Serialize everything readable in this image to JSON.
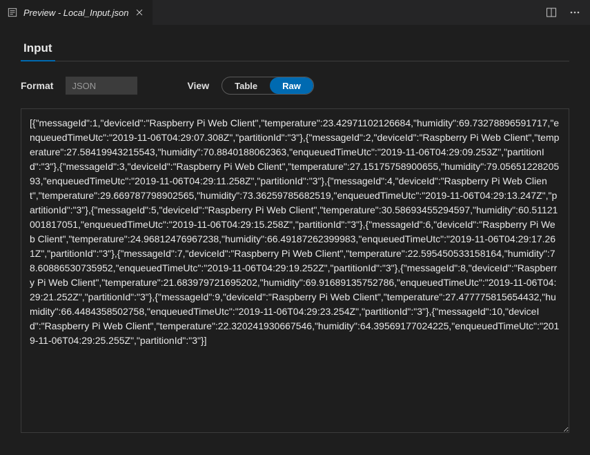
{
  "titlebar": {
    "tab_label": "Preview - Local_Input.json"
  },
  "section_tabs": {
    "input": "Input"
  },
  "controls": {
    "format_label": "Format",
    "format_value": "JSON",
    "view_label": "View",
    "view_table": "Table",
    "view_raw": "Raw"
  },
  "raw_content": "[{\"messageId\":1,\"deviceId\":\"Raspberry Pi Web Client\",\"temperature\":23.42971102126684,\"humidity\":69.73278896591717,\"enqueuedTimeUtc\":\"2019-11-06T04:29:07.308Z\",\"partitionId\":\"3\"},{\"messageId\":2,\"deviceId\":\"Raspberry Pi Web Client\",\"temperature\":27.58419943215543,\"humidity\":70.8840188062363,\"enqueuedTimeUtc\":\"2019-11-06T04:29:09.253Z\",\"partitionId\":\"3\"},{\"messageId\":3,\"deviceId\":\"Raspberry Pi Web Client\",\"temperature\":27.15175758900655,\"humidity\":79.0565122820593,\"enqueuedTimeUtc\":\"2019-11-06T04:29:11.258Z\",\"partitionId\":\"3\"},{\"messageId\":4,\"deviceId\":\"Raspberry Pi Web Client\",\"temperature\":29.669787798902565,\"humidity\":73.36259785682519,\"enqueuedTimeUtc\":\"2019-11-06T04:29:13.247Z\",\"partitionId\":\"3\"},{\"messageId\":5,\"deviceId\":\"Raspberry Pi Web Client\",\"temperature\":30.58693455294597,\"humidity\":60.51121001817051,\"enqueuedTimeUtc\":\"2019-11-06T04:29:15.258Z\",\"partitionId\":\"3\"},{\"messageId\":6,\"deviceId\":\"Raspberry Pi Web Client\",\"temperature\":24.96812476967238,\"humidity\":66.49187262399983,\"enqueuedTimeUtc\":\"2019-11-06T04:29:17.261Z\",\"partitionId\":\"3\"},{\"messageId\":7,\"deviceId\":\"Raspberry Pi Web Client\",\"temperature\":22.595450533158164,\"humidity\":78.60886530735952,\"enqueuedTimeUtc\":\"2019-11-06T04:29:19.252Z\",\"partitionId\":\"3\"},{\"messageId\":8,\"deviceId\":\"Raspberry Pi Web Client\",\"temperature\":21.683979721695202,\"humidity\":69.91689135752786,\"enqueuedTimeUtc\":\"2019-11-06T04:29:21.252Z\",\"partitionId\":\"3\"},{\"messageId\":9,\"deviceId\":\"Raspberry Pi Web Client\",\"temperature\":27.477775815654432,\"humidity\":66.4484358502758,\"enqueuedTimeUtc\":\"2019-11-06T04:29:23.254Z\",\"partitionId\":\"3\"},{\"messageId\":10,\"deviceId\":\"Raspberry Pi Web Client\",\"temperature\":22.320241930667546,\"humidity\":64.39569177024225,\"enqueuedTimeUtc\":\"2019-11-06T04:29:25.255Z\",\"partitionId\":\"3\"}]"
}
